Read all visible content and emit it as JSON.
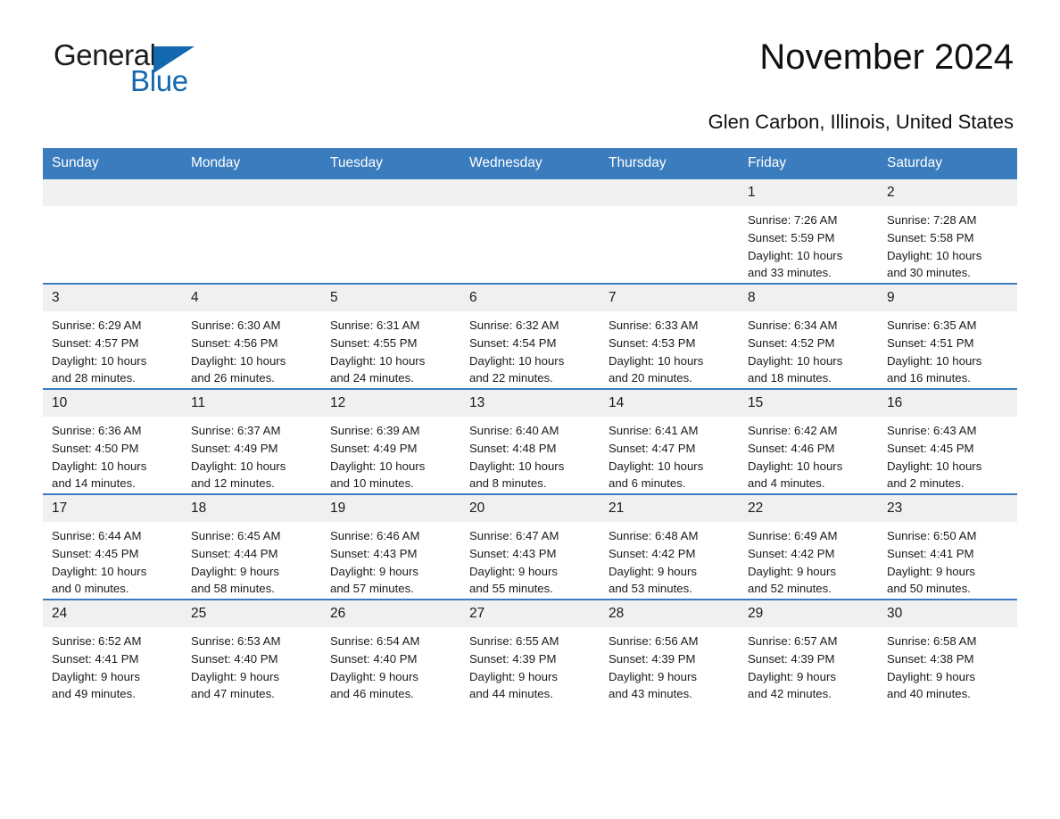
{
  "brand": {
    "word1": "General",
    "word2": "Blue",
    "triangle_color": "#1368b0",
    "logo_icon": "triangle-logo-icon"
  },
  "header": {
    "title": "November 2024",
    "subtitle": "Glen Carbon, Illinois, United States"
  },
  "colors": {
    "header_blue": "#3a7cbe",
    "daynum_gray": "#f0f0f0",
    "text": "#1a1a1a"
  },
  "calendar": {
    "weekday_headers": [
      "Sunday",
      "Monday",
      "Tuesday",
      "Wednesday",
      "Thursday",
      "Friday",
      "Saturday"
    ],
    "weeks": [
      [
        {
          "day": "",
          "sunrise": "",
          "sunset": "",
          "daylight_line1": "",
          "daylight_line2": "",
          "empty": true
        },
        {
          "day": "",
          "sunrise": "",
          "sunset": "",
          "daylight_line1": "",
          "daylight_line2": "",
          "empty": true
        },
        {
          "day": "",
          "sunrise": "",
          "sunset": "",
          "daylight_line1": "",
          "daylight_line2": "",
          "empty": true
        },
        {
          "day": "",
          "sunrise": "",
          "sunset": "",
          "daylight_line1": "",
          "daylight_line2": "",
          "empty": true
        },
        {
          "day": "",
          "sunrise": "",
          "sunset": "",
          "daylight_line1": "",
          "daylight_line2": "",
          "empty": true
        },
        {
          "day": "1",
          "sunrise": "Sunrise: 7:26 AM",
          "sunset": "Sunset: 5:59 PM",
          "daylight_line1": "Daylight: 10 hours",
          "daylight_line2": "and 33 minutes.",
          "empty": false
        },
        {
          "day": "2",
          "sunrise": "Sunrise: 7:28 AM",
          "sunset": "Sunset: 5:58 PM",
          "daylight_line1": "Daylight: 10 hours",
          "daylight_line2": "and 30 minutes.",
          "empty": false
        }
      ],
      [
        {
          "day": "3",
          "sunrise": "Sunrise: 6:29 AM",
          "sunset": "Sunset: 4:57 PM",
          "daylight_line1": "Daylight: 10 hours",
          "daylight_line2": "and 28 minutes.",
          "empty": false
        },
        {
          "day": "4",
          "sunrise": "Sunrise: 6:30 AM",
          "sunset": "Sunset: 4:56 PM",
          "daylight_line1": "Daylight: 10 hours",
          "daylight_line2": "and 26 minutes.",
          "empty": false
        },
        {
          "day": "5",
          "sunrise": "Sunrise: 6:31 AM",
          "sunset": "Sunset: 4:55 PM",
          "daylight_line1": "Daylight: 10 hours",
          "daylight_line2": "and 24 minutes.",
          "empty": false
        },
        {
          "day": "6",
          "sunrise": "Sunrise: 6:32 AM",
          "sunset": "Sunset: 4:54 PM",
          "daylight_line1": "Daylight: 10 hours",
          "daylight_line2": "and 22 minutes.",
          "empty": false
        },
        {
          "day": "7",
          "sunrise": "Sunrise: 6:33 AM",
          "sunset": "Sunset: 4:53 PM",
          "daylight_line1": "Daylight: 10 hours",
          "daylight_line2": "and 20 minutes.",
          "empty": false
        },
        {
          "day": "8",
          "sunrise": "Sunrise: 6:34 AM",
          "sunset": "Sunset: 4:52 PM",
          "daylight_line1": "Daylight: 10 hours",
          "daylight_line2": "and 18 minutes.",
          "empty": false
        },
        {
          "day": "9",
          "sunrise": "Sunrise: 6:35 AM",
          "sunset": "Sunset: 4:51 PM",
          "daylight_line1": "Daylight: 10 hours",
          "daylight_line2": "and 16 minutes.",
          "empty": false
        }
      ],
      [
        {
          "day": "10",
          "sunrise": "Sunrise: 6:36 AM",
          "sunset": "Sunset: 4:50 PM",
          "daylight_line1": "Daylight: 10 hours",
          "daylight_line2": "and 14 minutes.",
          "empty": false
        },
        {
          "day": "11",
          "sunrise": "Sunrise: 6:37 AM",
          "sunset": "Sunset: 4:49 PM",
          "daylight_line1": "Daylight: 10 hours",
          "daylight_line2": "and 12 minutes.",
          "empty": false
        },
        {
          "day": "12",
          "sunrise": "Sunrise: 6:39 AM",
          "sunset": "Sunset: 4:49 PM",
          "daylight_line1": "Daylight: 10 hours",
          "daylight_line2": "and 10 minutes.",
          "empty": false
        },
        {
          "day": "13",
          "sunrise": "Sunrise: 6:40 AM",
          "sunset": "Sunset: 4:48 PM",
          "daylight_line1": "Daylight: 10 hours",
          "daylight_line2": "and 8 minutes.",
          "empty": false
        },
        {
          "day": "14",
          "sunrise": "Sunrise: 6:41 AM",
          "sunset": "Sunset: 4:47 PM",
          "daylight_line1": "Daylight: 10 hours",
          "daylight_line2": "and 6 minutes.",
          "empty": false
        },
        {
          "day": "15",
          "sunrise": "Sunrise: 6:42 AM",
          "sunset": "Sunset: 4:46 PM",
          "daylight_line1": "Daylight: 10 hours",
          "daylight_line2": "and 4 minutes.",
          "empty": false
        },
        {
          "day": "16",
          "sunrise": "Sunrise: 6:43 AM",
          "sunset": "Sunset: 4:45 PM",
          "daylight_line1": "Daylight: 10 hours",
          "daylight_line2": "and 2 minutes.",
          "empty": false
        }
      ],
      [
        {
          "day": "17",
          "sunrise": "Sunrise: 6:44 AM",
          "sunset": "Sunset: 4:45 PM",
          "daylight_line1": "Daylight: 10 hours",
          "daylight_line2": "and 0 minutes.",
          "empty": false
        },
        {
          "day": "18",
          "sunrise": "Sunrise: 6:45 AM",
          "sunset": "Sunset: 4:44 PM",
          "daylight_line1": "Daylight: 9 hours",
          "daylight_line2": "and 58 minutes.",
          "empty": false
        },
        {
          "day": "19",
          "sunrise": "Sunrise: 6:46 AM",
          "sunset": "Sunset: 4:43 PM",
          "daylight_line1": "Daylight: 9 hours",
          "daylight_line2": "and 57 minutes.",
          "empty": false
        },
        {
          "day": "20",
          "sunrise": "Sunrise: 6:47 AM",
          "sunset": "Sunset: 4:43 PM",
          "daylight_line1": "Daylight: 9 hours",
          "daylight_line2": "and 55 minutes.",
          "empty": false
        },
        {
          "day": "21",
          "sunrise": "Sunrise: 6:48 AM",
          "sunset": "Sunset: 4:42 PM",
          "daylight_line1": "Daylight: 9 hours",
          "daylight_line2": "and 53 minutes.",
          "empty": false
        },
        {
          "day": "22",
          "sunrise": "Sunrise: 6:49 AM",
          "sunset": "Sunset: 4:42 PM",
          "daylight_line1": "Daylight: 9 hours",
          "daylight_line2": "and 52 minutes.",
          "empty": false
        },
        {
          "day": "23",
          "sunrise": "Sunrise: 6:50 AM",
          "sunset": "Sunset: 4:41 PM",
          "daylight_line1": "Daylight: 9 hours",
          "daylight_line2": "and 50 minutes.",
          "empty": false
        }
      ],
      [
        {
          "day": "24",
          "sunrise": "Sunrise: 6:52 AM",
          "sunset": "Sunset: 4:41 PM",
          "daylight_line1": "Daylight: 9 hours",
          "daylight_line2": "and 49 minutes.",
          "empty": false
        },
        {
          "day": "25",
          "sunrise": "Sunrise: 6:53 AM",
          "sunset": "Sunset: 4:40 PM",
          "daylight_line1": "Daylight: 9 hours",
          "daylight_line2": "and 47 minutes.",
          "empty": false
        },
        {
          "day": "26",
          "sunrise": "Sunrise: 6:54 AM",
          "sunset": "Sunset: 4:40 PM",
          "daylight_line1": "Daylight: 9 hours",
          "daylight_line2": "and 46 minutes.",
          "empty": false
        },
        {
          "day": "27",
          "sunrise": "Sunrise: 6:55 AM",
          "sunset": "Sunset: 4:39 PM",
          "daylight_line1": "Daylight: 9 hours",
          "daylight_line2": "and 44 minutes.",
          "empty": false
        },
        {
          "day": "28",
          "sunrise": "Sunrise: 6:56 AM",
          "sunset": "Sunset: 4:39 PM",
          "daylight_line1": "Daylight: 9 hours",
          "daylight_line2": "and 43 minutes.",
          "empty": false
        },
        {
          "day": "29",
          "sunrise": "Sunrise: 6:57 AM",
          "sunset": "Sunset: 4:39 PM",
          "daylight_line1": "Daylight: 9 hours",
          "daylight_line2": "and 42 minutes.",
          "empty": false
        },
        {
          "day": "30",
          "sunrise": "Sunrise: 6:58 AM",
          "sunset": "Sunset: 4:38 PM",
          "daylight_line1": "Daylight: 9 hours",
          "daylight_line2": "and 40 minutes.",
          "empty": false
        }
      ]
    ]
  }
}
